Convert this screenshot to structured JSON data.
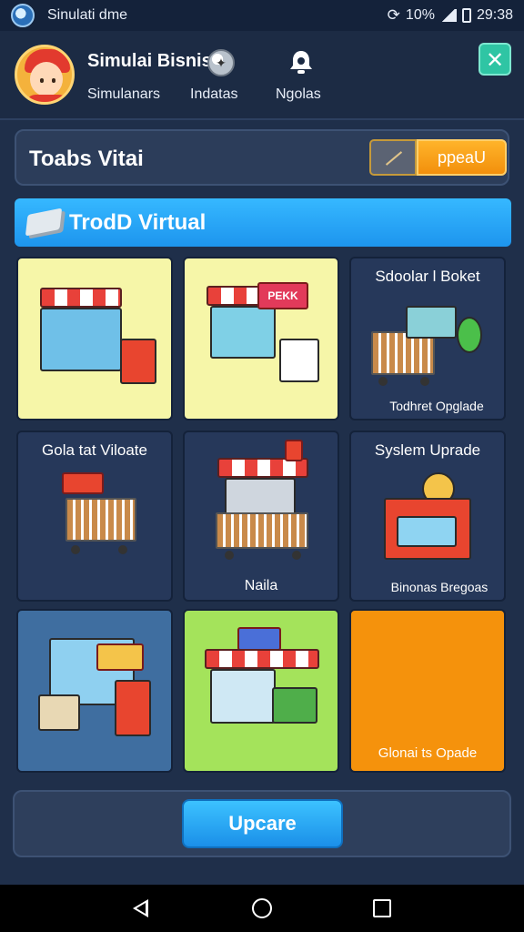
{
  "status_bar": {
    "title": "Sinulati dme",
    "time": "29:38",
    "indicators": "10%"
  },
  "header": {
    "app_name": "Simulai Bisnis",
    "nav": [
      "Simulanars",
      "Indatas",
      "Ngolas"
    ]
  },
  "tools": {
    "title": "Toabs Vitai",
    "upgrade_label": "ppeaU"
  },
  "section": {
    "title": "TrodD Virtual"
  },
  "tiles": [
    {
      "label": "",
      "sub": "",
      "color": "#f6f6a8"
    },
    {
      "label": "",
      "sub": "",
      "sign": "PEKK",
      "color": "#f6f6a8"
    },
    {
      "label": "Sdoolar l Boket",
      "sub": "Todhret Opglade",
      "color": "#26385a"
    },
    {
      "label": "Gola tat Viloate",
      "sub": "",
      "color": "#26385a"
    },
    {
      "label": "",
      "sub": "Naila",
      "color": "#26385a"
    },
    {
      "label": "Syslem Uprade",
      "sub": "Binonas Bregoas",
      "color": "#26385a"
    },
    {
      "label": "",
      "sub": "",
      "color": "#3f6ea0"
    },
    {
      "label": "",
      "sub": "",
      "color": "#a4e35b"
    },
    {
      "label": "",
      "sub": "Glonai ts Opade",
      "color": "#f5920c"
    }
  ],
  "footer": {
    "update_label": "Upcare"
  }
}
